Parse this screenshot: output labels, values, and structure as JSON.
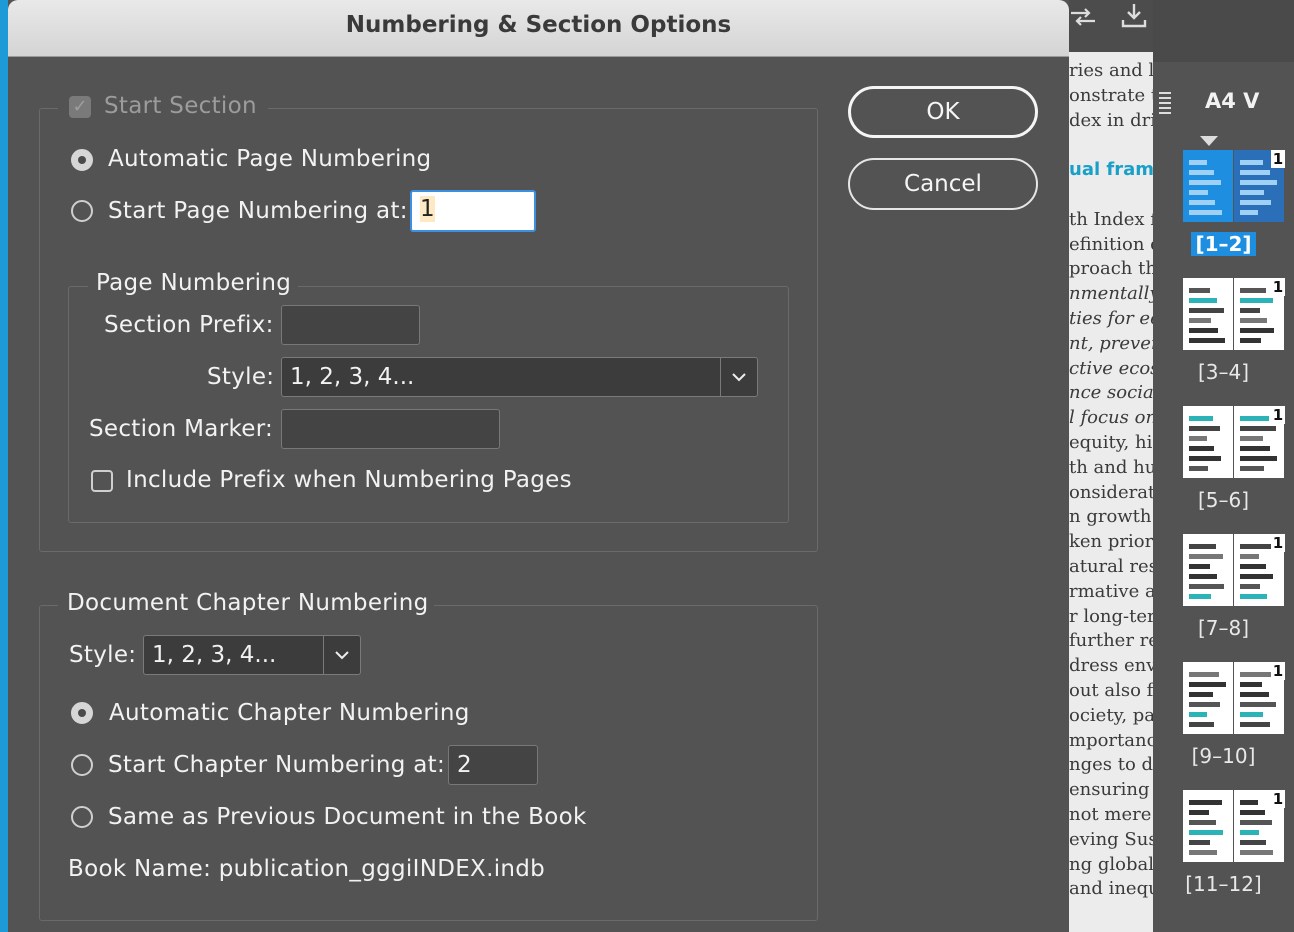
{
  "dialog": {
    "title": "Numbering & Section Options",
    "ok_label": "OK",
    "cancel_label": "Cancel"
  },
  "section": {
    "start_section_label": "Start Section",
    "start_section_checked": true,
    "auto_page_numbering_label": "Automatic Page Numbering",
    "start_page_numbering_label": "Start Page Numbering at:",
    "start_page_value": "1"
  },
  "page_numbering": {
    "heading": "Page Numbering",
    "section_prefix_label": "Section Prefix:",
    "section_prefix_value": "",
    "style_label": "Style:",
    "style_value": "1, 2, 3, 4...",
    "section_marker_label": "Section Marker:",
    "section_marker_value": "",
    "include_prefix_label": "Include Prefix when Numbering Pages"
  },
  "chapter_numbering": {
    "heading": "Document Chapter Numbering",
    "style_label": "Style:",
    "style_value": "1, 2, 3, 4...",
    "auto_chapter_label": "Automatic Chapter Numbering",
    "start_chapter_label": "Start Chapter Numbering at:",
    "start_chapter_value": "2",
    "same_as_previous_label": "Same as Previous Document in the Book",
    "book_name_label": "Book Name: publication_gggiINDEX.indb"
  },
  "document_preview": {
    "lines": [
      "ries and li",
      "onstrate t",
      "dex in dri",
      "",
      "ual fram",
      "",
      "th Index fi",
      "efinition c",
      "proach tha",
      "nmentally",
      "ties for ec",
      "nt, prevent",
      "ctive ecos",
      "nce social i",
      "l focus on",
      "equity, hig",
      "th and hu",
      "onsideratio",
      "n growth",
      "ken priorit",
      "atural reso",
      "rmative a",
      "r long-ter",
      "further re",
      "dress envi",
      "out also fo",
      "ociety, par",
      "mportanc",
      "nges to dr",
      "ensuring",
      "not mere",
      "eving Sus",
      "ng global",
      "and inequ"
    ],
    "accent_color": "#1aa0c8"
  },
  "pages_panel": {
    "master_label": "A4 V",
    "spreads": [
      "[1–2]",
      "[3–4]",
      "[5–6]",
      "[7–8]",
      "[9–10]",
      "[11–12]"
    ],
    "page_number_badge": "1",
    "selected_color": "#1e8fe0"
  }
}
